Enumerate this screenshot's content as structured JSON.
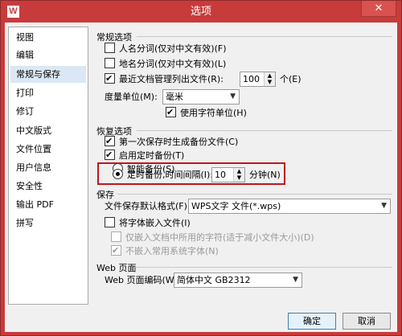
{
  "window": {
    "title": "选项",
    "app_icon_letter": "W",
    "close_glyph": "✕",
    "frame_color": "#c83b3b"
  },
  "sidebar": {
    "items": [
      {
        "label": "视图"
      },
      {
        "label": "编辑"
      },
      {
        "label": "常规与保存",
        "active": true
      },
      {
        "label": "打印"
      },
      {
        "label": "修订"
      },
      {
        "label": "中文版式"
      },
      {
        "label": "文件位置"
      },
      {
        "label": "用户信息"
      },
      {
        "label": "安全性"
      },
      {
        "label": "输出 PDF"
      },
      {
        "label": "拼写"
      }
    ]
  },
  "general": {
    "title": "常规选项",
    "person_name": {
      "label": "人名分词(仅对中文有效)(F)",
      "checked": false
    },
    "place_name": {
      "label": "地名分词(仅对中文有效)(L)",
      "checked": false
    },
    "recent_files": {
      "label": "最近文档管理列出文件(R):",
      "checked": true,
      "value": "100",
      "unit": "个(E)"
    },
    "measure_unit": {
      "label": "度量单位(M):",
      "value": "毫米"
    },
    "char_unit": {
      "label": "使用字符单位(H)",
      "checked": true
    }
  },
  "recovery": {
    "title": "恢复选项",
    "first_backup": {
      "label": "第一次保存时生成备份文件(C)",
      "checked": true
    },
    "timed_backup": {
      "label": "启用定时备份(T)",
      "checked": true
    },
    "smart_backup": {
      "label": "智能备份(S)",
      "selected": false
    },
    "timed_interval": {
      "label": "定时备份,时间间隔(I):",
      "selected": true,
      "value": "10",
      "unit": "分钟(N)"
    }
  },
  "save": {
    "title": "保存",
    "default_format": {
      "label": "文件保存默认格式(F):",
      "value": "WPS文字 文件(*.wps)"
    },
    "embed_fonts": {
      "label": "将字体嵌入文件(I)",
      "checked": false
    },
    "embed_used_only": {
      "label": "仅嵌入文档中所用的字符(适于减小文件大小)(D)",
      "checked": false
    },
    "skip_common": {
      "label": "不嵌入常用系统字体(N)",
      "checked": true
    }
  },
  "web": {
    "title": "Web 页面",
    "encoding": {
      "label": "Web 页面编码(W):",
      "value": "简体中文 GB2312"
    }
  },
  "buttons": {
    "ok": "确定",
    "cancel": "取消"
  },
  "colors": {
    "highlight_box": "#c0161a",
    "selected_nav": "#dce7f5"
  }
}
